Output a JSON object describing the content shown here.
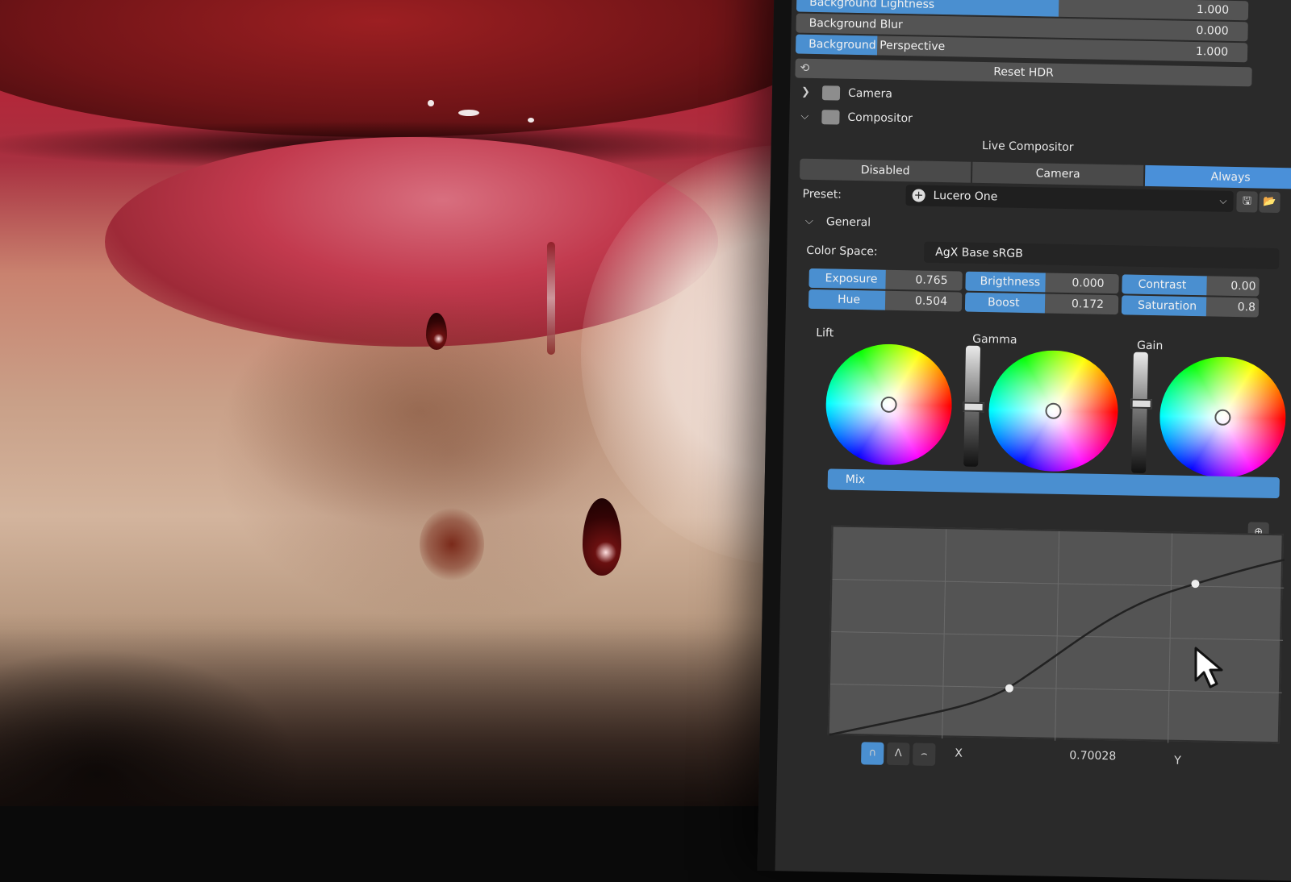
{
  "panel": {
    "background": {
      "lightness": {
        "label": "Background Lightness",
        "value": "1.000",
        "fill": 0.58
      },
      "blur": {
        "label": "Background Blur",
        "value": "0.000",
        "fill": 0.0
      },
      "perspective": {
        "label": "Background Perspective",
        "value": "1.000",
        "fill": 0.18
      }
    },
    "reset_hdr_label": "Reset HDR",
    "camera_label": "Camera",
    "compositor_label": "Compositor",
    "live_compositor": {
      "title": "Live Compositor",
      "modes": [
        "Disabled",
        "Camera",
        "Always"
      ],
      "active_mode": "Always"
    },
    "preset": {
      "label": "Preset:",
      "value": "Lucero One"
    },
    "general_label": "General",
    "color_space": {
      "label": "Color Space:",
      "value": "AgX Base sRGB"
    },
    "adjustments": {
      "exposure": {
        "label": "Exposure",
        "value": "0.765"
      },
      "brightness": {
        "label": "Brigthness",
        "value": "0.000"
      },
      "contrast": {
        "label": "Contrast",
        "value": "0.00"
      },
      "hue": {
        "label": "Hue",
        "value": "0.504"
      },
      "boost": {
        "label": "Boost",
        "value": "0.172"
      },
      "saturation": {
        "label": "Saturation",
        "value": "0.8"
      }
    },
    "wheels": {
      "lift": "Lift",
      "gamma": "Gamma",
      "gain": "Gain"
    },
    "mix_label": "Mix",
    "curve": {
      "x_label": "X",
      "x_value": "0.70028",
      "y_label": "Y"
    }
  },
  "colors": {
    "accent": "#4a8fd0",
    "panel_bg": "#2a2a2a",
    "field_bg": "#545454"
  }
}
